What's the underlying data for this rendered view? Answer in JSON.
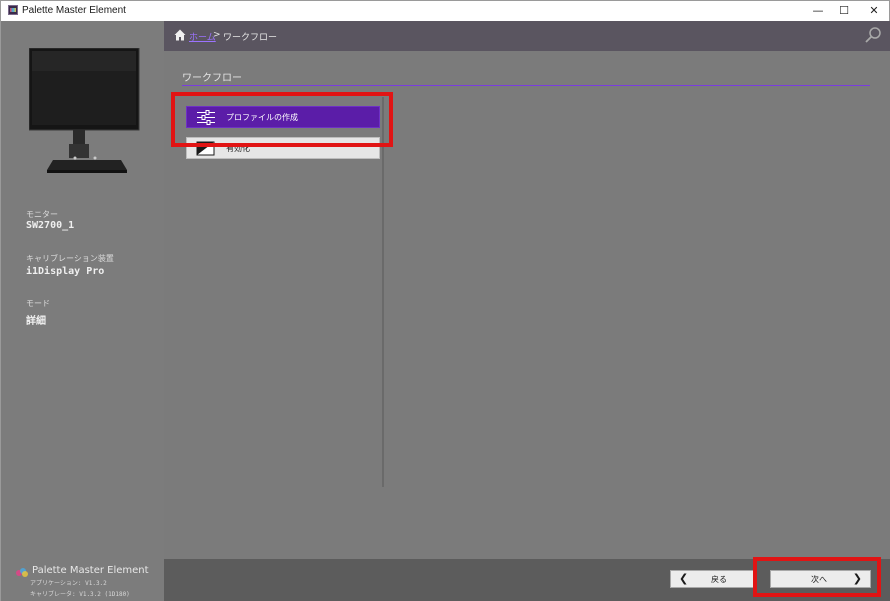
{
  "window": {
    "title": "Palette Master Element",
    "controls": {
      "minimize": "—",
      "maximize": "☐",
      "close": "✕"
    }
  },
  "sidebar": {
    "monitor_label": "モニター",
    "monitor_value": "SW2700_1",
    "calibrator_label": "キャリブレーション装置",
    "calibrator_value": "i1Display Pro",
    "mode_label": "モード",
    "mode_value": "詳細",
    "brand_name": "Palette Master Element",
    "app_version": "アプリケーション: V1.3.2",
    "calibrator_version": "キャリブレータ: V1.3.2 (1D180)"
  },
  "breadcrumb": {
    "home": "ホーム",
    "separator": ">",
    "current": "ワークフロー"
  },
  "main": {
    "section_title": "ワークフロー",
    "workflow_items": [
      {
        "label": "プロファイルの作成",
        "selected": true,
        "icon": "sliders-icon"
      },
      {
        "label": "有効化",
        "selected": false,
        "icon": "validation-icon"
      }
    ]
  },
  "footer": {
    "back_label": "戻る",
    "next_label": "次へ"
  },
  "colors": {
    "accent": "#5b1da8",
    "highlight": "#e11414",
    "sidebar_bg": "#7c7c7c",
    "topbar_bg": "#5a5560"
  }
}
